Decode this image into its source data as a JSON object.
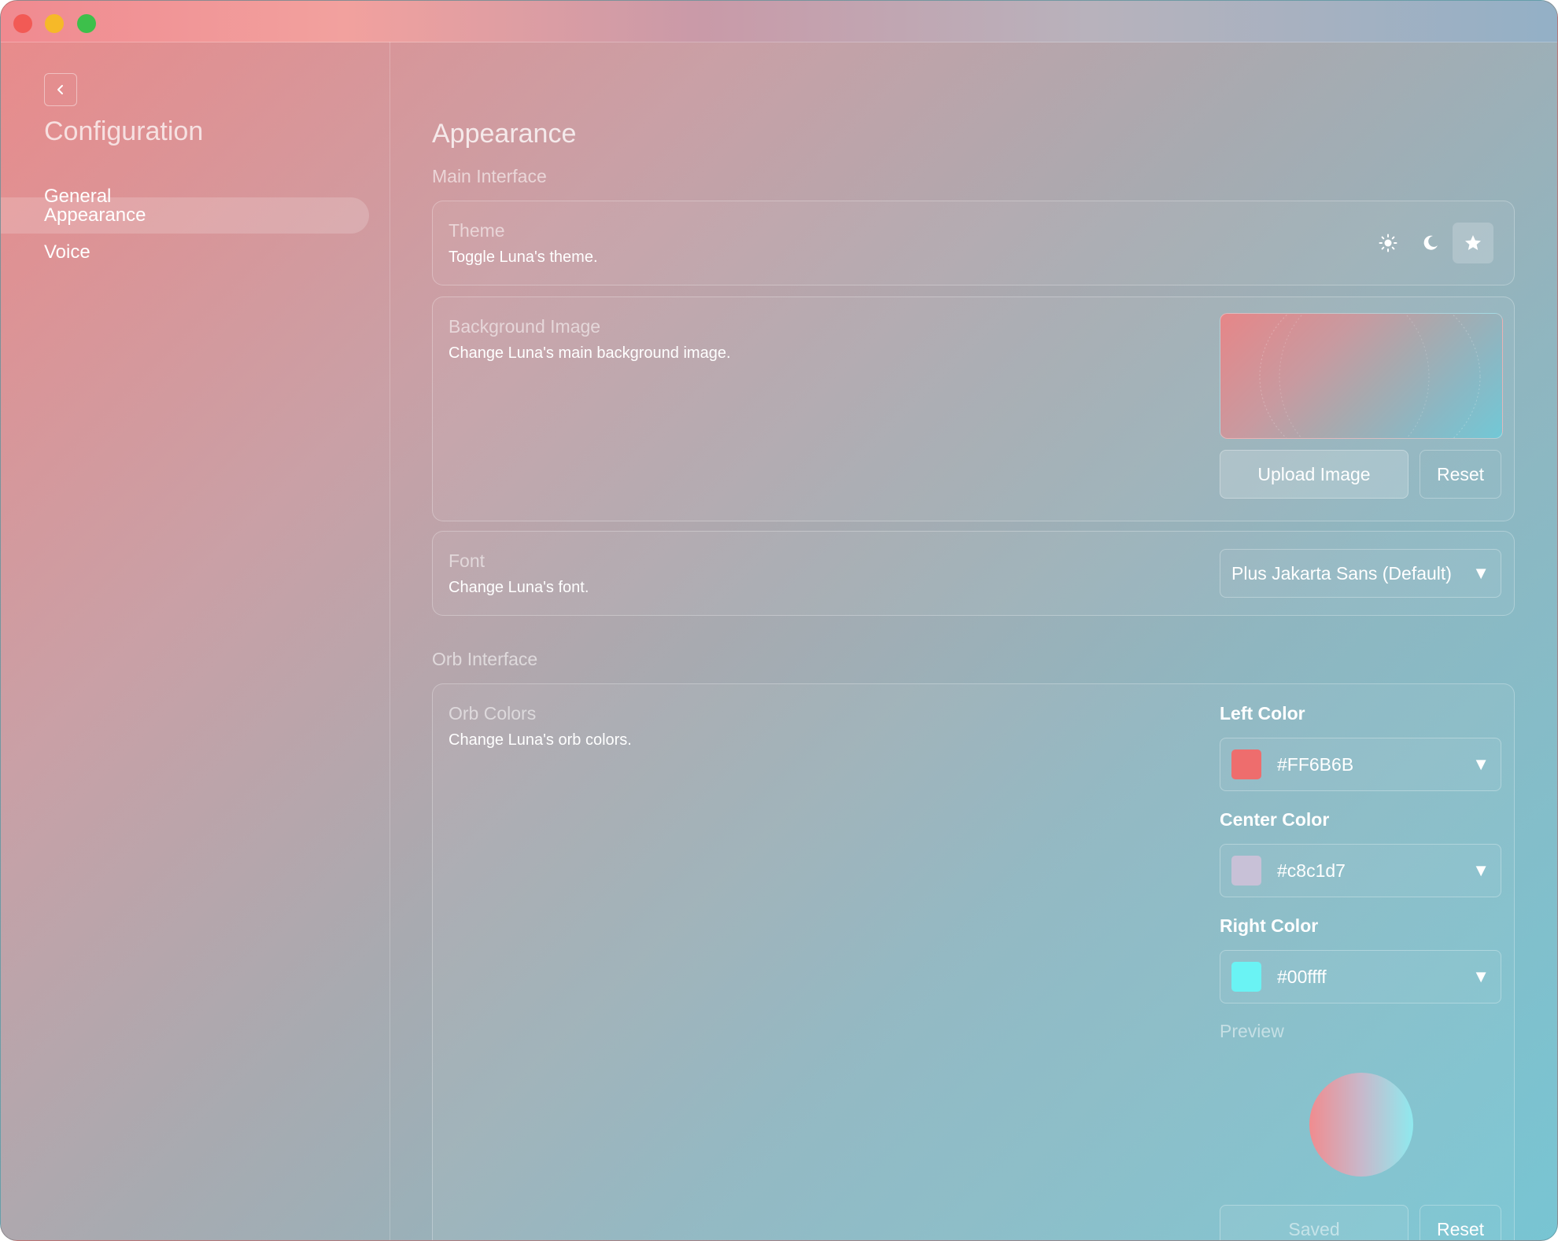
{
  "sidebar": {
    "title": "Configuration",
    "items": [
      {
        "label": "General"
      },
      {
        "label": "Appearance",
        "active": true
      },
      {
        "label": "Voice"
      }
    ]
  },
  "main": {
    "title": "Appearance",
    "main_interface_label": "Main Interface",
    "theme": {
      "title": "Theme",
      "description": "Toggle Luna's theme.",
      "options": [
        "sun-icon",
        "moon-icon",
        "star-icon"
      ],
      "selected": "star-icon"
    },
    "background": {
      "title": "Background Image",
      "description": "Change Luna's main background image.",
      "upload_label": "Upload Image",
      "reset_label": "Reset"
    },
    "font": {
      "title": "Font",
      "description": "Change Luna's font.",
      "selected": "Plus Jakarta Sans (Default)"
    },
    "orb_interface_label": "Orb Interface",
    "orb_colors": {
      "title": "Orb Colors",
      "description": "Change Luna's orb colors.",
      "left": {
        "label": "Left Color",
        "value": "#FF6B6B",
        "swatch": "#ee6d6d"
      },
      "center": {
        "label": "Center Color",
        "value": "#c8c1d7",
        "swatch": "#c8c1d7"
      },
      "right": {
        "label": "Right Color",
        "value": "#00ffff",
        "swatch": "#6af3f4"
      },
      "preview_label": "Preview",
      "saved_label": "Saved",
      "reset_label": "Reset"
    }
  }
}
